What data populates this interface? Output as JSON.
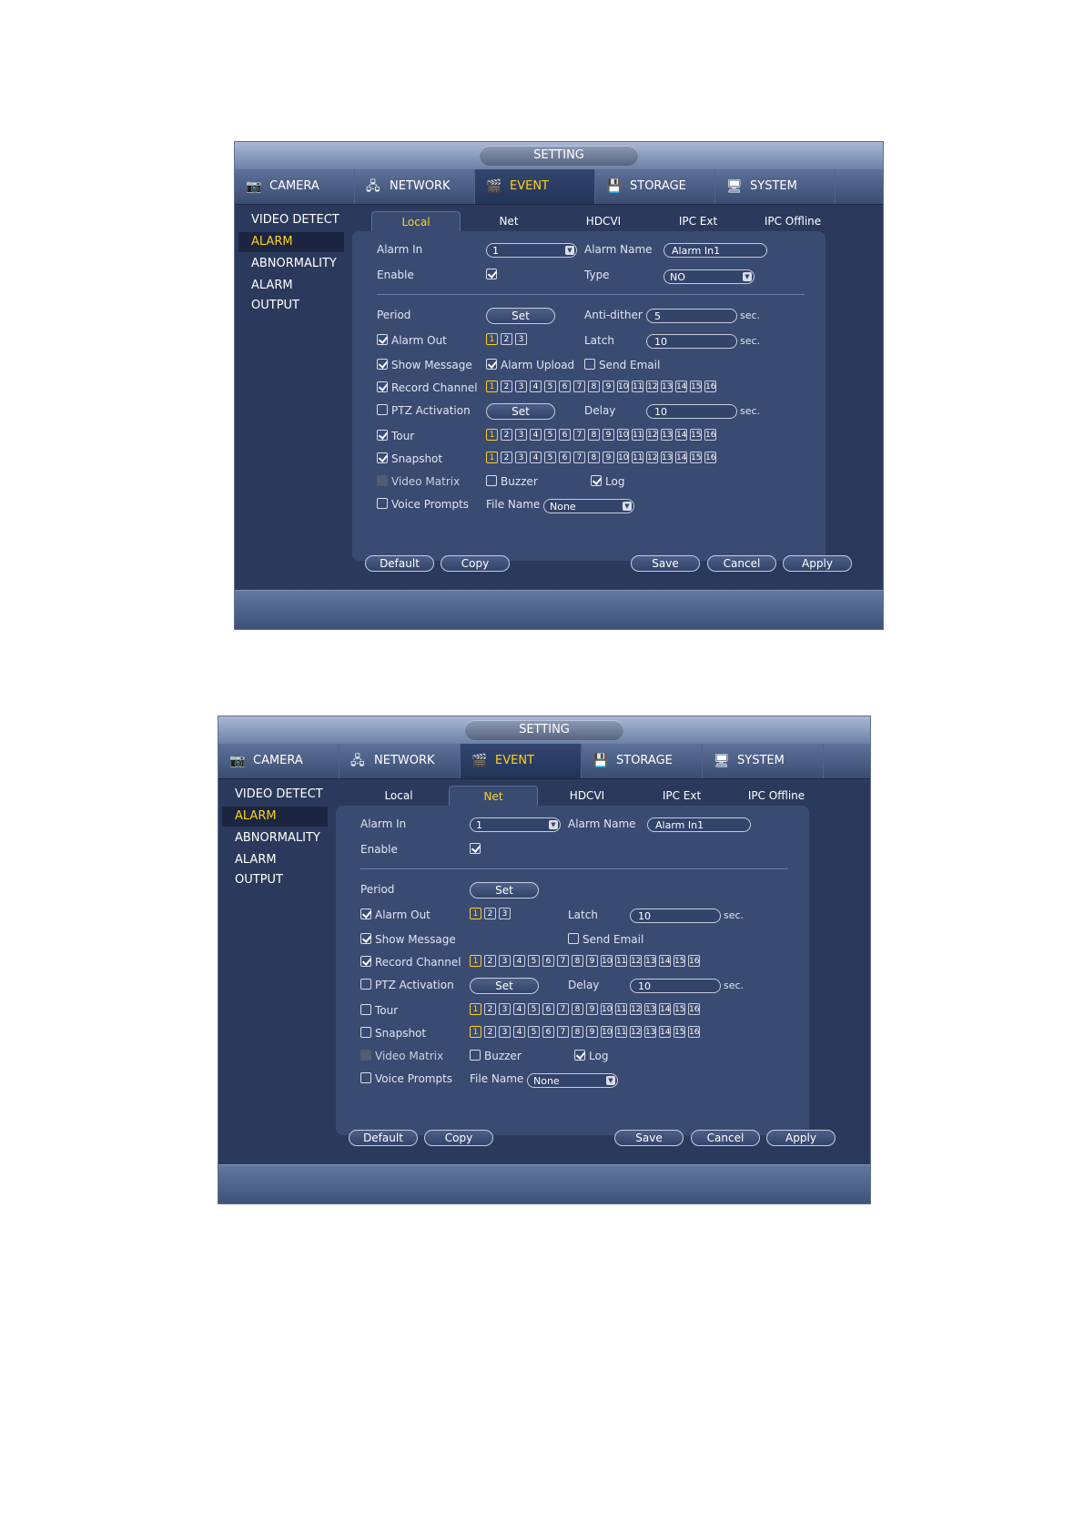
{
  "window1": {
    "title": "SETTING",
    "tabs": [
      {
        "label": "CAMERA",
        "icon": "camera-icon"
      },
      {
        "label": "NETWORK",
        "icon": "network-icon"
      },
      {
        "label": "EVENT",
        "icon": "event-icon"
      },
      {
        "label": "STORAGE",
        "icon": "storage-icon"
      },
      {
        "label": "SYSTEM",
        "icon": "system-icon"
      }
    ],
    "active_tab": "EVENT",
    "sidebar": [
      "VIDEO DETECT",
      "ALARM",
      "ABNORMALITY",
      "ALARM OUTPUT"
    ],
    "active_sidebar": "ALARM",
    "subtabs": [
      "Local",
      "Net",
      "HDCVI",
      "IPC Ext",
      "IPC Offline"
    ],
    "active_subtab": "Local",
    "alarm_in_label": "Alarm In",
    "alarm_in_value": "1",
    "alarm_name_label": "Alarm Name",
    "alarm_name_value": "Alarm In1",
    "enable_label": "Enable",
    "type_label": "Type",
    "type_value": "NO",
    "period_label": "Period",
    "set_label": "Set",
    "anti_dither_label": "Anti-dither",
    "anti_dither_value": "5",
    "sec_label": "sec.",
    "alarm_out_label": "Alarm Out",
    "alarm_out_channels": [
      "1",
      "2",
      "3"
    ],
    "latch_label": "Latch",
    "latch_value": "10",
    "show_message_label": "Show Message",
    "alarm_upload_label": "Alarm Upload",
    "send_email_label": "Send Email",
    "record_channel_label": "Record Channel",
    "ptz_activation_label": "PTZ Activation",
    "delay_label": "Delay",
    "delay_value": "10",
    "tour_label": "Tour",
    "snapshot_label": "Snapshot",
    "video_matrix_label": "Video Matrix",
    "buzzer_label": "Buzzer",
    "log_label": "Log",
    "voice_prompts_label": "Voice Prompts",
    "file_name_label": "File Name",
    "file_name_value": "None",
    "buttons": {
      "default": "Default",
      "copy": "Copy",
      "save": "Save",
      "cancel": "Cancel",
      "apply": "Apply"
    }
  },
  "window2": {
    "title": "SETTING",
    "tabs": [
      {
        "label": "CAMERA",
        "icon": "camera-icon"
      },
      {
        "label": "NETWORK",
        "icon": "network-icon"
      },
      {
        "label": "EVENT",
        "icon": "event-icon"
      },
      {
        "label": "STORAGE",
        "icon": "storage-icon"
      },
      {
        "label": "SYSTEM",
        "icon": "system-icon"
      }
    ],
    "active_tab": "EVENT",
    "sidebar": [
      "VIDEO DETECT",
      "ALARM",
      "ABNORMALITY",
      "ALARM OUTPUT"
    ],
    "active_sidebar": "ALARM",
    "subtabs": [
      "Local",
      "Net",
      "HDCVI",
      "IPC Ext",
      "IPC Offline"
    ],
    "active_subtab": "Net",
    "alarm_in_label": "Alarm In",
    "alarm_in_value": "1",
    "alarm_name_label": "Alarm Name",
    "alarm_name_value": "Alarm In1",
    "enable_label": "Enable",
    "period_label": "Period",
    "set_label": "Set",
    "sec_label": "sec.",
    "alarm_out_label": "Alarm Out",
    "alarm_out_channels": [
      "1",
      "2",
      "3"
    ],
    "latch_label": "Latch",
    "latch_value": "10",
    "show_message_label": "Show Message",
    "send_email_label": "Send Email",
    "record_channel_label": "Record Channel",
    "ptz_activation_label": "PTZ Activation",
    "delay_label": "Delay",
    "delay_value": "10",
    "tour_label": "Tour",
    "snapshot_label": "Snapshot",
    "video_matrix_label": "Video Matrix",
    "buzzer_label": "Buzzer",
    "log_label": "Log",
    "voice_prompts_label": "Voice Prompts",
    "file_name_label": "File Name",
    "file_name_value": "None",
    "buttons": {
      "default": "Default",
      "copy": "Copy",
      "save": "Save",
      "cancel": "Cancel",
      "apply": "Apply"
    }
  },
  "channels": [
    "1",
    "2",
    "3",
    "4",
    "5",
    "6",
    "7",
    "8",
    "9",
    "10",
    "11",
    "12",
    "13",
    "14",
    "15",
    "16"
  ],
  "colors": {
    "panel": "#3a4b72",
    "accent": "#ffd11a",
    "background": "#2b3a5c"
  }
}
